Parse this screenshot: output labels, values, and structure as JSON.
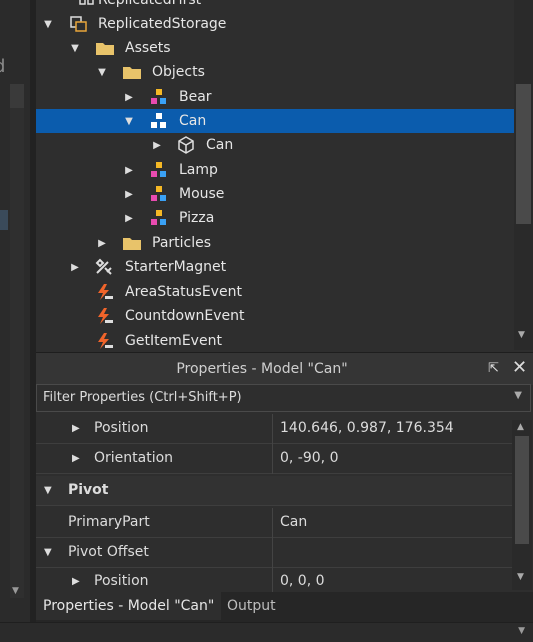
{
  "explorer": {
    "items": [
      {
        "label": "ReplicatedFirst",
        "icon": "replicated-first-icon",
        "arrow": ""
      },
      {
        "label": "ReplicatedStorage",
        "icon": "replicated-storage-icon",
        "arrow": "expanded"
      },
      {
        "label": "Assets",
        "icon": "folder-icon",
        "arrow": "expanded"
      },
      {
        "label": "Objects",
        "icon": "folder-icon",
        "arrow": "expanded"
      },
      {
        "label": "Bear",
        "icon": "model-icon",
        "arrow": "collapsed"
      },
      {
        "label": "Can",
        "icon": "model-icon",
        "arrow": "expanded",
        "selected": true
      },
      {
        "label": "Can",
        "icon": "mesh-part-icon",
        "arrow": "collapsed"
      },
      {
        "label": "Lamp",
        "icon": "model-icon",
        "arrow": "collapsed"
      },
      {
        "label": "Mouse",
        "icon": "model-icon",
        "arrow": "collapsed"
      },
      {
        "label": "Pizza",
        "icon": "model-icon",
        "arrow": "collapsed"
      },
      {
        "label": "Particles",
        "icon": "folder-icon",
        "arrow": "collapsed"
      },
      {
        "label": "StarterMagnet",
        "icon": "tool-icon",
        "arrow": "collapsed"
      },
      {
        "label": "AreaStatusEvent",
        "icon": "remote-event-icon",
        "arrow": ""
      },
      {
        "label": "CountdownEvent",
        "icon": "remote-event-icon",
        "arrow": ""
      },
      {
        "label": "GetItemEvent",
        "icon": "remote-event-icon",
        "arrow": ""
      }
    ]
  },
  "properties": {
    "title": "Properties - Model \"Can\"",
    "filter_placeholder": "Filter Properties (Ctrl+Shift+P)",
    "rows": [
      {
        "name": "Position",
        "value": "140.646, 0.987, 176.354"
      },
      {
        "name": "Orientation",
        "value": "0, -90, 0"
      },
      {
        "name": "Pivot",
        "value": ""
      },
      {
        "name": "PrimaryPart",
        "value": "Can"
      },
      {
        "name": "Pivot Offset",
        "value": ""
      },
      {
        "name": "Position",
        "value": "0, 0, 0"
      }
    ]
  },
  "tabs": [
    {
      "label": "Properties - Model \"Can\""
    },
    {
      "label": "Output"
    }
  ],
  "colors": {
    "selection": "#0b5cad",
    "background": "#2e2e2e",
    "folder": "#e8c36a",
    "event": "#f0642a"
  }
}
